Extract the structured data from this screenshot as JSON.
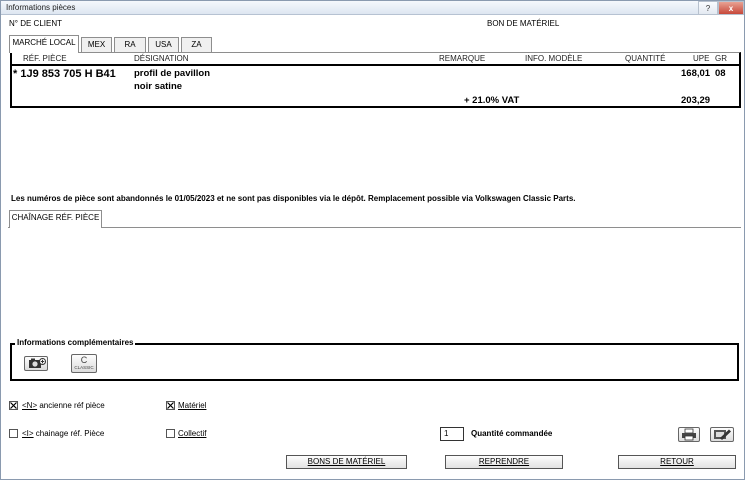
{
  "window": {
    "title": "Informations pièces",
    "help_glyph": "?",
    "close_glyph": "x"
  },
  "header": {
    "client_label": "N° DE CLIENT",
    "order_type": "BON DE MATÉRIEL"
  },
  "tabs": [
    "MARCHÉ LOCAL",
    "MEX",
    "RA",
    "USA",
    "ZA"
  ],
  "table": {
    "columns": [
      "RÉF. PIÈCE",
      "DÉSIGNATION",
      "REMARQUE",
      "INFO. MODÈLE",
      "QUANTITÉ",
      "UPE",
      "GR"
    ],
    "row": {
      "ref": "* 1J9 853 705 H  B41",
      "designation_1": "profil de pavillon",
      "designation_2": "noir satine",
      "upe": "168,01",
      "gr": "08"
    },
    "vat_label": "+ 21.0% VAT",
    "vat_total": "203,29"
  },
  "notice": "Les numéros de pièce sont abandonnés le 01/05/2023 et ne sont pas disponibles via le dépôt. Remplacement possible via Volkswagen Classic Parts.",
  "lower_tab": "CHAÎNAGE RÉF. PIÈCE",
  "info_section": {
    "title": "Informations complémentaires",
    "classic_glyph": "C",
    "classic_text": "CLASSIC",
    "camera_icon": "camera-plus-icon"
  },
  "options": {
    "ancienne_ref": {
      "prefix": "<N>",
      "label": " ancienne réf pièce",
      "checked": true
    },
    "chainage_ref": {
      "prefix": "<I>",
      "label": " chainage réf. Pièce",
      "checked": false
    },
    "materiel": {
      "label": "Matériel",
      "checked": true
    },
    "collectif": {
      "label": "Collectif",
      "checked": false
    }
  },
  "quantity": {
    "value": "1",
    "label": "Quantité commandée"
  },
  "buttons": {
    "bons": "BONS DE MATÉRIEL",
    "reprendre": "REPRENDRE",
    "retour": "RETOUR"
  }
}
